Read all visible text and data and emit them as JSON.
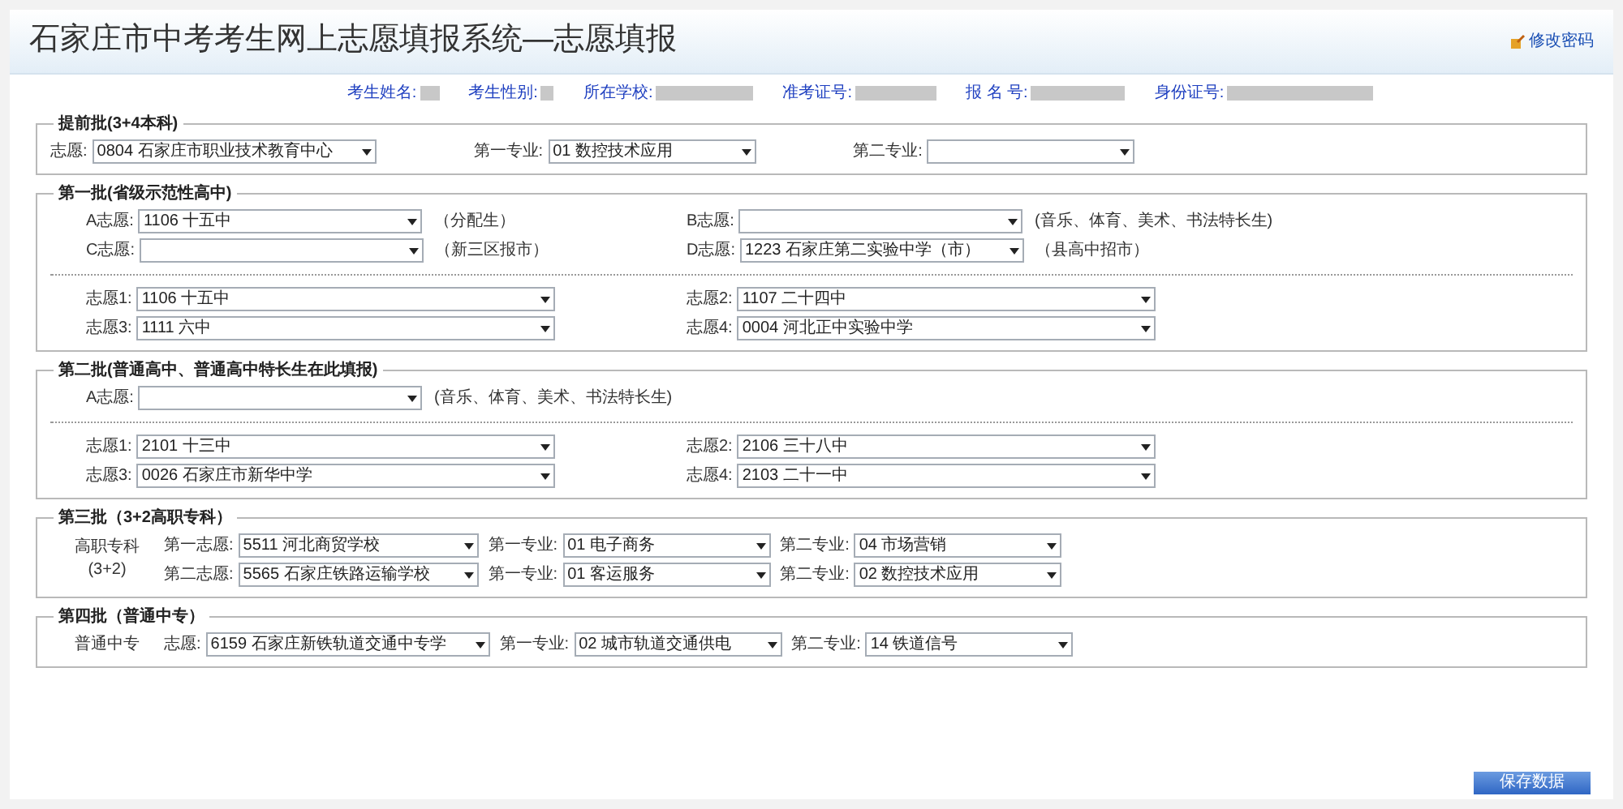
{
  "title": "石家庄市中考考生网上志愿填报系统—志愿填报",
  "change_password": "修改密码",
  "student_info": [
    {
      "label": "考生姓名:"
    },
    {
      "label": "考生性别:"
    },
    {
      "label": "所在学校:"
    },
    {
      "label": "准考证号:"
    },
    {
      "label": "报 名 号:"
    },
    {
      "label": "身份证号:"
    }
  ],
  "sections": [
    {
      "title": "提前批(3+4本科)",
      "kind": "spaced",
      "groups": [
        [
          [
            {
              "label": "志愿:",
              "kind": "wide",
              "value": "0804 石家庄市职业技术教育中心"
            },
            {
              "label": "第一专业:",
              "kind": "short",
              "value": "01 数控技术应用"
            },
            {
              "label": "第二专业:",
              "kind": "short"
            }
          ]
        ]
      ]
    },
    {
      "title": "第一批(省级示范性高中)",
      "kind": "pair",
      "groups": [
        [
          [
            {
              "label": "A志愿:",
              "kind": "wide",
              "value": "1106 十五中",
              "note": "（分配生）"
            },
            {
              "label": "B志愿:",
              "kind": "wide",
              "note": "(音乐、体育、美术、书法特长生)"
            }
          ],
          [
            {
              "label": "C志愿:",
              "kind": "wide",
              "note": "（新三区报市）"
            },
            {
              "label": "D志愿:",
              "kind": "wide",
              "value": "1223 石家庄第二实验中学（市）",
              "note": "（县高中招市）"
            }
          ]
        ],
        [
          [
            {
              "label": "志愿1:",
              "kind": "long",
              "value": "1106 十五中"
            },
            {
              "label": "志愿2:",
              "kind": "long",
              "value": "1107 二十四中"
            }
          ],
          [
            {
              "label": "志愿3:",
              "kind": "long",
              "value": "1111 六中"
            },
            {
              "label": "志愿4:",
              "kind": "long",
              "value": "0004 河北正中实验中学"
            }
          ]
        ]
      ]
    },
    {
      "title": "第二批(普通高中、普通高中特长生在此填报)",
      "kind": "pair",
      "groups": [
        [
          [
            {
              "label": "A志愿:",
              "kind": "wide",
              "note": "(音乐、体育、美术、书法特长生)"
            }
          ]
        ],
        [
          [
            {
              "label": "志愿1:",
              "kind": "long",
              "value": "2101 十三中"
            },
            {
              "label": "志愿2:",
              "kind": "long",
              "value": "2106 三十八中"
            }
          ],
          [
            {
              "label": "志愿3:",
              "kind": "long",
              "value": "0026 石家庄市新华中学"
            },
            {
              "label": "志愿4:",
              "kind": "long",
              "value": "2103 二十一中"
            }
          ]
        ]
      ]
    },
    {
      "title": "第三批（3+2高职专科）",
      "kind": "inline",
      "side_label": [
        "高职专科",
        "(3+2)"
      ],
      "groups": [
        [
          [
            {
              "label": "第一志愿:",
              "kind": "mid",
              "value": "5511 河北商贸学校"
            },
            {
              "label": "第一专业:",
              "kind": "short",
              "value": "01 电子商务"
            },
            {
              "label": "第二专业:",
              "kind": "short",
              "value": "04 市场营销"
            }
          ],
          [
            {
              "label": "第二志愿:",
              "kind": "mid",
              "value": "5565 石家庄铁路运输学校"
            },
            {
              "label": "第一专业:",
              "kind": "short",
              "value": "01 客运服务"
            },
            {
              "label": "第二专业:",
              "kind": "short",
              "value": "02 数控技术应用"
            }
          ]
        ]
      ]
    },
    {
      "title": "第四批（普通中专）",
      "kind": "inline",
      "side_label": [
        "普通中专"
      ],
      "groups": [
        [
          [
            {
              "label": "志愿:",
              "kind": "wide",
              "value": "6159 石家庄新铁轨道交通中专学"
            },
            {
              "label": "第一专业:",
              "kind": "short",
              "value": "02 城市轨道交通供电"
            },
            {
              "label": "第二专业:",
              "kind": "short",
              "value": "14 铁道信号"
            }
          ]
        ]
      ]
    }
  ],
  "save_button": "保存数据"
}
